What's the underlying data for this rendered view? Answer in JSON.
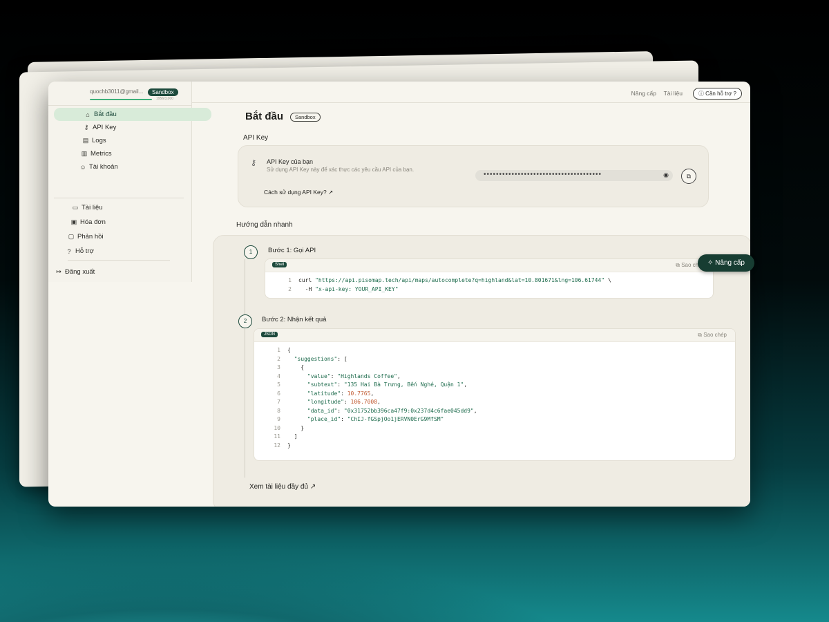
{
  "account": {
    "email": "quochb3011@gmail...",
    "plan_badge": "Sandbox",
    "quota": "1956/3,000"
  },
  "sidebar": {
    "main": [
      {
        "label": "Bắt đầu",
        "icon": "home-icon"
      },
      {
        "label": "API Key",
        "icon": "key-icon"
      },
      {
        "label": "Logs",
        "icon": "log-icon"
      },
      {
        "label": "Metrics",
        "icon": "chart-icon"
      },
      {
        "label": "Tài khoản",
        "icon": "user-icon"
      }
    ],
    "secondary": [
      {
        "label": "Tài liệu",
        "icon": "book-icon"
      },
      {
        "label": "Hóa đơn",
        "icon": "receipt-icon"
      },
      {
        "label": "Phản hồi",
        "icon": "message-icon"
      },
      {
        "label": "Hỗ trợ",
        "icon": "help-icon"
      }
    ],
    "logout": "Đăng xuất"
  },
  "topbar": {
    "upgrade": "Nâng cấp",
    "docs": "Tài liệu",
    "help": "Cần hỗ trợ ?"
  },
  "page": {
    "title": "Bắt đầu",
    "badge": "Sandbox"
  },
  "api_key": {
    "section_label": "API Key",
    "title": "API Key của bạn",
    "description": "Sử dụng API Key này để xác thực các yêu cầu API của bạn.",
    "link": "Cách sử dụng API Key?",
    "masked": "••••••••••••••••••••••••••••••••••••••"
  },
  "quick": {
    "section_label": "Hướng dẫn nhanh",
    "step1": {
      "num": "1",
      "title": "Bước 1: Gọi API",
      "lang": "Shell",
      "copy": "Sao chép"
    },
    "step2": {
      "num": "2",
      "title": "Bước 2: Nhận kết quả",
      "lang": "JSON",
      "copy": "Sao chép"
    },
    "docs_link": "Xem tài liệu đầy đủ"
  },
  "code_shell": [
    {
      "n": "1",
      "parts": [
        [
          "p",
          "curl "
        ],
        [
          "s",
          "\"https://api.pisomap.tech/api/maps/autocomplete?q=highland&lat=10.801671&lng=106.61744\""
        ],
        [
          "p",
          " \\"
        ]
      ]
    },
    {
      "n": "2",
      "parts": [
        [
          "p",
          "  -H "
        ],
        [
          "s",
          "\"x-api-key: YOUR_API_KEY\""
        ]
      ]
    }
  ],
  "code_json": [
    {
      "n": "1",
      "parts": [
        [
          "p",
          "{"
        ]
      ]
    },
    {
      "n": "2",
      "parts": [
        [
          "p",
          "  "
        ],
        [
          "s",
          "\"suggestions\""
        ],
        [
          "p",
          ": ["
        ]
      ]
    },
    {
      "n": "3",
      "parts": [
        [
          "p",
          "    {"
        ]
      ]
    },
    {
      "n": "4",
      "parts": [
        [
          "p",
          "      "
        ],
        [
          "s",
          "\"value\""
        ],
        [
          "p",
          ": "
        ],
        [
          "s",
          "\"Highlands Coffee\""
        ],
        [
          "p",
          ","
        ]
      ]
    },
    {
      "n": "5",
      "parts": [
        [
          "p",
          "      "
        ],
        [
          "s",
          "\"subtext\""
        ],
        [
          "p",
          ": "
        ],
        [
          "s",
          "\"135 Hai Bà Trưng, Bến Nghé, Quận 1\""
        ],
        [
          "p",
          ","
        ]
      ]
    },
    {
      "n": "6",
      "parts": [
        [
          "p",
          "      "
        ],
        [
          "s",
          "\"latitude\""
        ],
        [
          "p",
          ": "
        ],
        [
          "n",
          "10.7765"
        ],
        [
          "p",
          ","
        ]
      ]
    },
    {
      "n": "7",
      "parts": [
        [
          "p",
          "      "
        ],
        [
          "s",
          "\"longitude\""
        ],
        [
          "p",
          ": "
        ],
        [
          "n",
          "106.7008"
        ],
        [
          "p",
          ","
        ]
      ]
    },
    {
      "n": "8",
      "parts": [
        [
          "p",
          "      "
        ],
        [
          "s",
          "\"data_id\""
        ],
        [
          "p",
          ": "
        ],
        [
          "s",
          "\"0x31752bb396ca47f9:0x237d4c6fae045dd9\""
        ],
        [
          "p",
          ","
        ]
      ]
    },
    {
      "n": "9",
      "parts": [
        [
          "p",
          "      "
        ],
        [
          "s",
          "\"place_id\""
        ],
        [
          "p",
          ": "
        ],
        [
          "s",
          "\"ChIJ-fGSpjOo1jERVN0ErG9MfSM\""
        ]
      ]
    },
    {
      "n": "10",
      "parts": [
        [
          "p",
          "    }"
        ]
      ]
    },
    {
      "n": "11",
      "parts": [
        [
          "p",
          "  ]"
        ]
      ]
    },
    {
      "n": "12",
      "parts": [
        [
          "p",
          "}"
        ]
      ]
    }
  ],
  "fab": {
    "label": "Nâng cấp"
  },
  "colors": {
    "accent": "#1d4a3c",
    "string": "#1d6b4c",
    "number": "#c0582f"
  }
}
